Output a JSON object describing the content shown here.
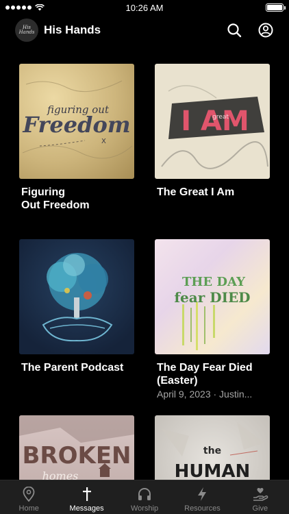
{
  "status_bar": {
    "time": "10:26 AM",
    "battery_level": 1.0
  },
  "header": {
    "logo_text": "His Hands",
    "title": "His Hands",
    "search_icon": "search-icon",
    "profile_icon": "account-circle-icon"
  },
  "series": [
    {
      "title": "Figuring\nOut Freedom",
      "meta": "",
      "art": {
        "line1": "figuring out",
        "line2": "Freedom",
        "mark": "X"
      }
    },
    {
      "title": "The Great I Am",
      "meta": "",
      "art": {
        "line1": "I AM",
        "small": "great"
      }
    },
    {
      "title": "The Parent Podcast",
      "meta": "",
      "art": {}
    },
    {
      "title": "The Day Fear Died (Easter)",
      "meta": "April 9, 2023 · Justin...",
      "art": {
        "line1": "THE DAY",
        "line2": "fear DIED"
      }
    },
    {
      "title": "",
      "meta": "",
      "art": {
        "line1": "BROKEN",
        "line2": "homes"
      }
    },
    {
      "title": "",
      "meta": "",
      "art": {
        "line1": "the",
        "line2": "HUMAN"
      }
    }
  ],
  "tabs": [
    {
      "label": "Home",
      "icon": "map-pin-icon",
      "active": false
    },
    {
      "label": "Messages",
      "icon": "cross-icon",
      "active": true
    },
    {
      "label": "Worship",
      "icon": "headphones-icon",
      "active": false
    },
    {
      "label": "Resources",
      "icon": "lightning-icon",
      "active": false
    },
    {
      "label": "Give",
      "icon": "hand-heart-icon",
      "active": false
    }
  ],
  "colors": {
    "background": "#000000",
    "tab_bar": "#1f1f1f",
    "tab_inactive": "#8a8a8a",
    "meta_text": "#a6a6a6"
  }
}
